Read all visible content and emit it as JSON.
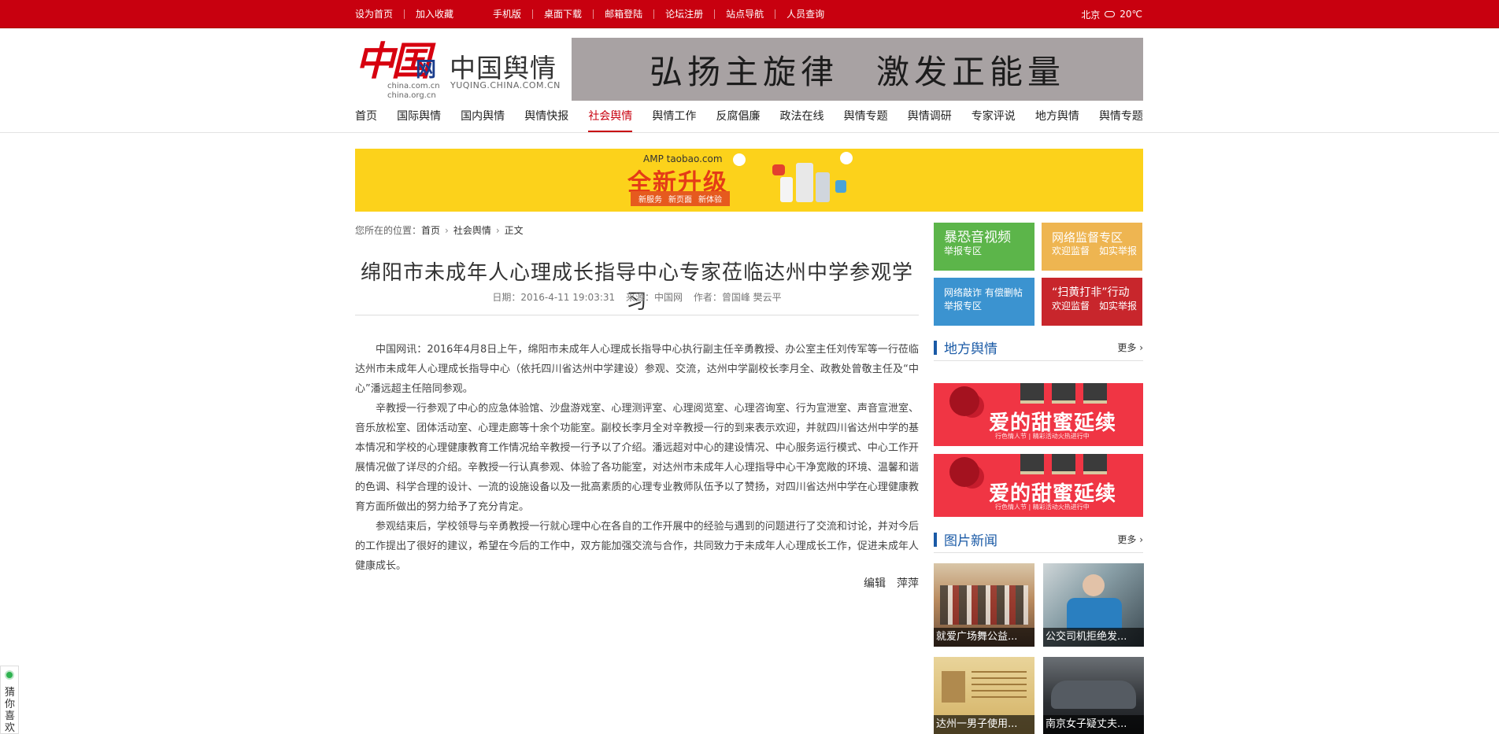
{
  "topbar": {
    "links": [
      "设为首页",
      "加入收藏",
      "手机版",
      "桌面下载",
      "邮箱登陆",
      "论坛注册",
      "站点导航",
      "人员查询"
    ],
    "city": "北京",
    "temperature": "20℃",
    "weather_icon": "cloud-icon"
  },
  "header": {
    "logo_text": "中国",
    "logo_wang": "网",
    "logo_domain1": "china.com.cn",
    "logo_domain2": "china.org.cn",
    "site_title": "中国舆情",
    "site_subtitle": "YUQING.CHINA.COM.CN",
    "banner_text": "弘扬主旋律　激发正能量"
  },
  "nav": {
    "items": [
      "首页",
      "国际舆情",
      "国内舆情",
      "舆情快报",
      "社会舆情",
      "舆情工作",
      "反腐倡廉",
      "政法在线",
      "舆情专题",
      "舆情调研",
      "专家评说",
      "地方舆情",
      "舆情专题"
    ],
    "active_index": 4
  },
  "ad_banner": {
    "domain": "AMP taobao.com",
    "headline": "全新升级",
    "chips": [
      "新服务",
      "新页面",
      "新体验"
    ]
  },
  "breadcrumb": {
    "prefix": "您所在的位置：",
    "home": "首页",
    "section": "社会舆情",
    "current": "正文"
  },
  "article": {
    "title": "绵阳市未成年人心理成长指导中心专家莅临达州中学参观学习",
    "date_label": "日期：",
    "date": "2016-4-11 19:03:31",
    "source_label": "来源：",
    "source": "中国网",
    "author_label": "作者：",
    "author": "曾国峰 樊云平",
    "paragraphs": [
      "中国网讯：2016年4月8日上午，绵阳市未成年人心理成长指导中心执行副主任辛勇教授、办公室主任刘传军等一行莅临达州市未成年人心理成长指导中心（依托四川省达州中学建设）参观、交流，达州中学副校长李月全、政教处曾敬主任及“中心”潘远超主任陪同参观。",
      "辛教授一行参观了中心的应急体验馆、沙盘游戏室、心理测评室、心理阅览室、心理咨询室、行为宣泄室、声音宣泄室、音乐放松室、团体活动室、心理走廊等十余个功能室。副校长李月全对辛教授一行的到来表示欢迎，并就四川省达州中学的基本情况和学校的心理健康教育工作情况给辛教授一行予以了介绍。潘远超对中心的建设情况、中心服务运行模式、中心工作开展情况做了详尽的介绍。辛教授一行认真参观、体验了各功能室，对达州市未成年人心理指导中心干净宽敞的环境、温馨和谐的色调、科学合理的设计、一流的设施设备以及一批高素质的心理专业教师队伍予以了赞扬，对四川省达州中学在心理健康教育方面所做出的努力给予了充分肯定。",
      "参观结束后，学校领导与辛勇教授一行就心理中心在各自的工作开展中的经验与遇到的问题进行了交流和讨论，并对今后的工作提出了很好的建议，希望在今后的工作中，双方能加强交流与合作，共同致力于未成年人心理成长工作，促进未成年人健康成长。"
    ],
    "editor": "编辑　萍萍"
  },
  "sidebar": {
    "tiles": [
      {
        "line1": "暴恐音视频",
        "line2": "举报专区",
        "color": "#5cb54a"
      },
      {
        "line1": "网络监督专区",
        "line2": "欢迎监督　如实举报",
        "color": "#eeb551"
      },
      {
        "line1": "网络敲诈 有偿删帖",
        "line2": "举报专区",
        "color": "#3b93d0"
      },
      {
        "line1": "“扫黄打非”行动",
        "line2": "欢迎监督　如实举报",
        "color": "#c8262c"
      }
    ],
    "local_title": "地方舆情",
    "local_more": "更多",
    "love_ad": {
      "text": "爱的甜蜜延续",
      "small": "行色情人节 | 精彩活动火热进行中"
    },
    "photo_title": "图片新闻",
    "photo_more": "更多",
    "photos": [
      {
        "caption": "就爱广场舞公益..."
      },
      {
        "caption": "公交司机拒绝发..."
      },
      {
        "caption": "达州一男子使用..."
      },
      {
        "caption": "南京女子疑丈夫..."
      }
    ]
  },
  "float_widget": {
    "label": "猜你喜欢"
  }
}
